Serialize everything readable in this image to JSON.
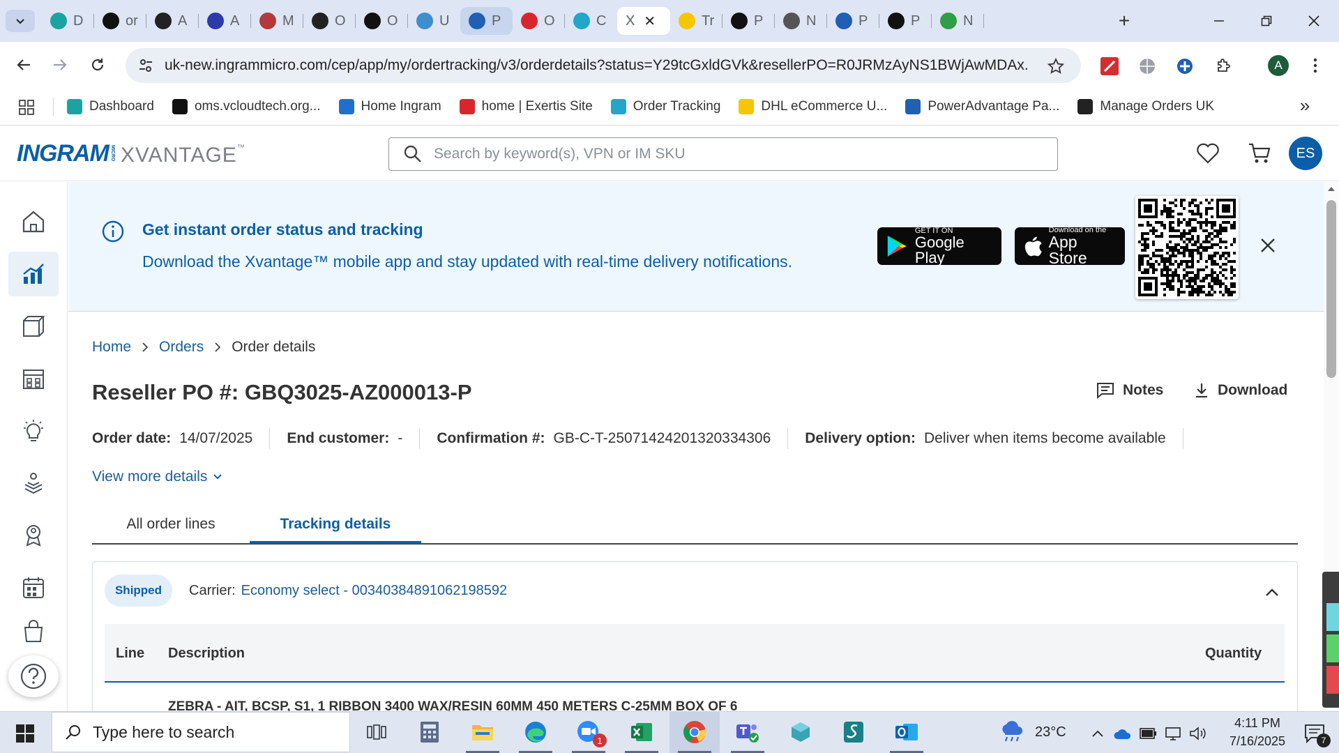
{
  "browser": {
    "tabs": [
      {
        "label": "D",
        "icon": "xvantage-tab-icon",
        "color": "#1aa3a3"
      },
      {
        "label": "or",
        "icon": "vcloudtech-tab-icon",
        "color": "#111111"
      },
      {
        "label": "A",
        "icon": "amazon-tab-icon",
        "color": "#222222"
      },
      {
        "label": "A",
        "icon": "arrow-tab-icon",
        "color": "#2d3ba8"
      },
      {
        "label": "M",
        "icon": "multi-circle-tab-icon",
        "color": "#b33a3a"
      },
      {
        "label": "O",
        "icon": "openai-tab-icon",
        "color": "#222222"
      },
      {
        "label": "O",
        "icon": "openai-tab-icon",
        "color": "#111111"
      },
      {
        "label": "U",
        "icon": "globe-tab-icon",
        "color": "#3e8ed0"
      },
      {
        "label": "P",
        "icon": "e-tab-icon",
        "color": "#1f5fb4"
      },
      {
        "label": "O",
        "icon": "exertis-tab-icon",
        "color": "#d9262d"
      },
      {
        "label": "C",
        "icon": "c-tab-icon",
        "color": "#22a6c9"
      },
      {
        "label": "X",
        "icon": "",
        "color": ""
      },
      {
        "label": "Tr",
        "icon": "dhl-tab-icon",
        "color": "#f7c600"
      },
      {
        "label": "P",
        "icon": "penguin-tab-icon",
        "color": "#111111"
      },
      {
        "label": "N",
        "icon": "chrome-tab-icon",
        "color": "#555555"
      },
      {
        "label": "P",
        "icon": "e-tab-icon",
        "color": "#1f5fb4"
      },
      {
        "label": "P",
        "icon": "penguin-tab-icon",
        "color": "#111111"
      },
      {
        "label": "N",
        "icon": "nx-tab-icon",
        "color": "#2f9e44"
      }
    ],
    "url": "uk-new.ingrammicro.com/cep/app/my/ordertracking/v3/orderdetails?status=Y29tcGxldGVk&resellerPO=R0JRMzAyNS1BWjAwMDAx...",
    "profile_initial": "A",
    "bookmarks": [
      {
        "label": "Dashboard",
        "icon": "xvantage-bookmark-icon",
        "color": "#1aa3a3"
      },
      {
        "label": "oms.vcloudtech.org...",
        "icon": "vcloudtech-bookmark-icon",
        "color": "#111111"
      },
      {
        "label": "Home Ingram",
        "icon": "ingram-bookmark-icon",
        "color": "#1f6fd0"
      },
      {
        "label": "home | Exertis Site",
        "icon": "exertis-bookmark-icon",
        "color": "#d9262d"
      },
      {
        "label": "Order Tracking",
        "icon": "c-bookmark-icon",
        "color": "#22a6c9"
      },
      {
        "label": "DHL eCommerce U...",
        "icon": "dhl-bookmark-icon",
        "color": "#f7c600"
      },
      {
        "label": "PowerAdvantage Pa...",
        "icon": "e-bookmark-icon",
        "color": "#1f5fb4"
      },
      {
        "label": "Manage Orders UK",
        "icon": "amazon-bookmark-icon",
        "color": "#222222"
      }
    ],
    "bookmarks_more": "»"
  },
  "app": {
    "logo_ingram": "INGRAM",
    "logo_micro": "MICRO",
    "logo_xvantage": "XVANTAGE",
    "logo_tm": "™",
    "search_placeholder": "Search by keyword(s), VPN or IM SKU",
    "user_initials": "ES",
    "brand_color": "#0b5ea8"
  },
  "banner": {
    "title": "Get instant order status and tracking",
    "subtitle": "Download the Xvantage™ mobile app and stay updated with real-time delivery notifications.",
    "google_small": "GET IT ON",
    "google_big": "Google Play",
    "apple_small": "Download on the",
    "apple_big": "App Store"
  },
  "breadcrumb": {
    "home": "Home",
    "orders": "Orders",
    "current": "Order details"
  },
  "order": {
    "title": "Reseller PO #: GBQ3025-AZ000013-P",
    "notes_label": "Notes",
    "download_label": "Download",
    "order_date_label": "Order date:",
    "order_date": "14/07/2025",
    "end_customer_label": "End customer:",
    "end_customer": "-",
    "confirmation_label": "Confirmation #:",
    "confirmation": "GB-C-T-25071424201320334306",
    "delivery_label": "Delivery option:",
    "delivery": "Deliver when items become available",
    "view_more": "View more details"
  },
  "tabs": {
    "all_lines": "All order lines",
    "tracking": "Tracking details"
  },
  "shipment": {
    "status": "Shipped",
    "carrier_label": "Carrier:",
    "carrier_value": "Economy select - 00340384891062198592",
    "col_line": "Line",
    "col_description": "Description",
    "col_quantity": "Quantity",
    "row_description": "ZEBRA - AIT, BCSP, S1, 1 RIBBON 3400 WAX/RESIN 60MM 450 METERS C-25MM BOX OF 6"
  },
  "taskbar": {
    "search_placeholder": "Type here to search",
    "weather": "23°C",
    "time": "4:11 PM",
    "date": "7/16/2025",
    "notification_count": "7",
    "zoom_badge": "1"
  }
}
